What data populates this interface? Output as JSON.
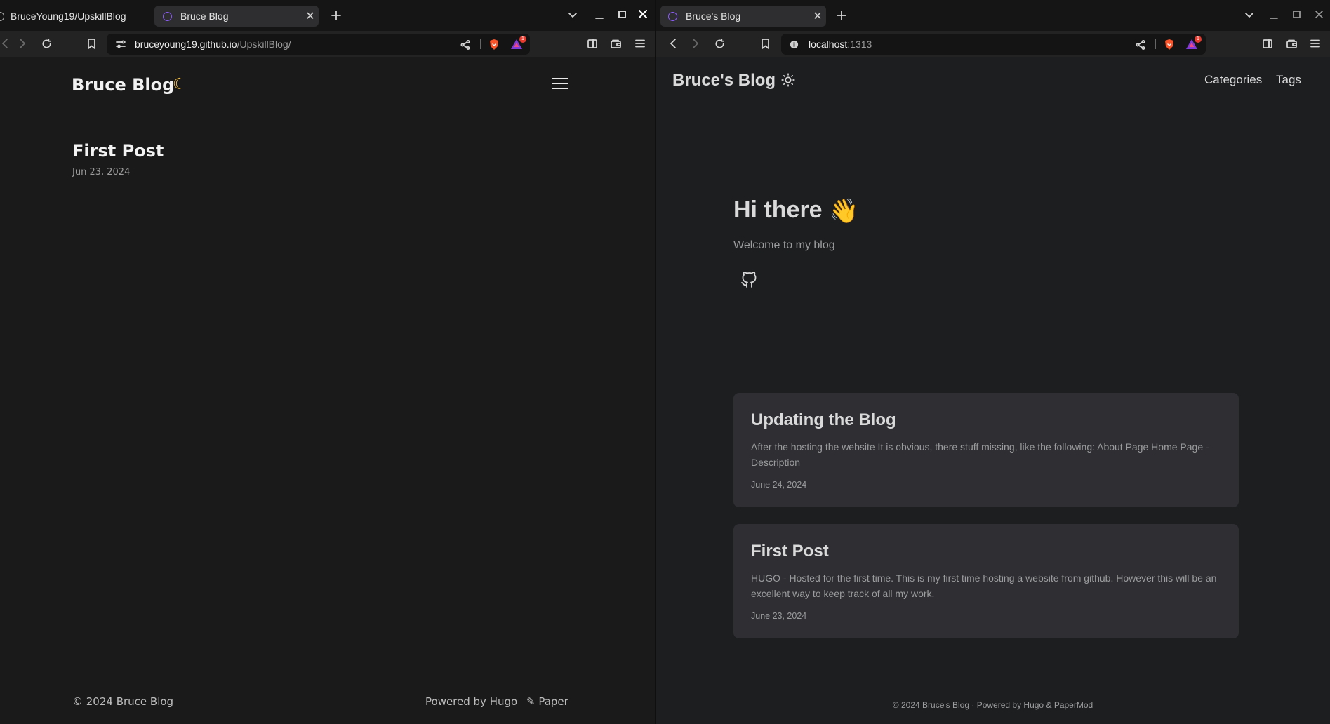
{
  "left_window": {
    "tabs": [
      {
        "title": "BruceYoung19/UpskillBlog",
        "active": false
      },
      {
        "title": "Bruce Blog",
        "active": true
      }
    ],
    "url_host": "bruceyoung19.github.io",
    "url_path": "/UpskillBlog/",
    "brave_badge": "1",
    "page": {
      "site_title": "Bruce Blog",
      "theme_icon": "moon-icon",
      "menu_icon": "hamburger-menu-icon",
      "post": {
        "title": "First Post",
        "date": "Jun 23, 2024"
      },
      "footer": {
        "copyright": "© 2024 Bruce Blog",
        "powered": "Powered by Hugo",
        "theme": "✎ Paper"
      }
    }
  },
  "right_window": {
    "tabs": [
      {
        "title": "Bruce's Blog",
        "active": true
      }
    ],
    "url_host": "localhost",
    "url_port": ":1313",
    "brave_badge": "1",
    "page": {
      "site_title": "Bruce's Blog",
      "theme_icon": "sun-icon",
      "menu": [
        "Categories",
        "Tags"
      ],
      "hero": {
        "title": "Hi there",
        "emoji": "👋",
        "subtitle": "Welcome to my blog"
      },
      "social_icon": "github-icon",
      "posts": [
        {
          "title": "Updating the Blog",
          "summary": "After the hosting the website It is obvious, there stuff missing, like the following: About Page Home Page - Description",
          "date": "June 24, 2024"
        },
        {
          "title": "First Post",
          "summary": "HUGO - Hosted for the first time. This is my first time hosting a website from github. However this will be an excellent way to keep track of all my work.",
          "date": "June 23, 2024"
        }
      ],
      "footer": {
        "copyright": "© 2024",
        "site_link": "Bruce's Blog",
        "sep": "·",
        "powered": "Powered by",
        "hugo": "Hugo",
        "amp": "&",
        "papermod": "PaperMod"
      }
    }
  }
}
